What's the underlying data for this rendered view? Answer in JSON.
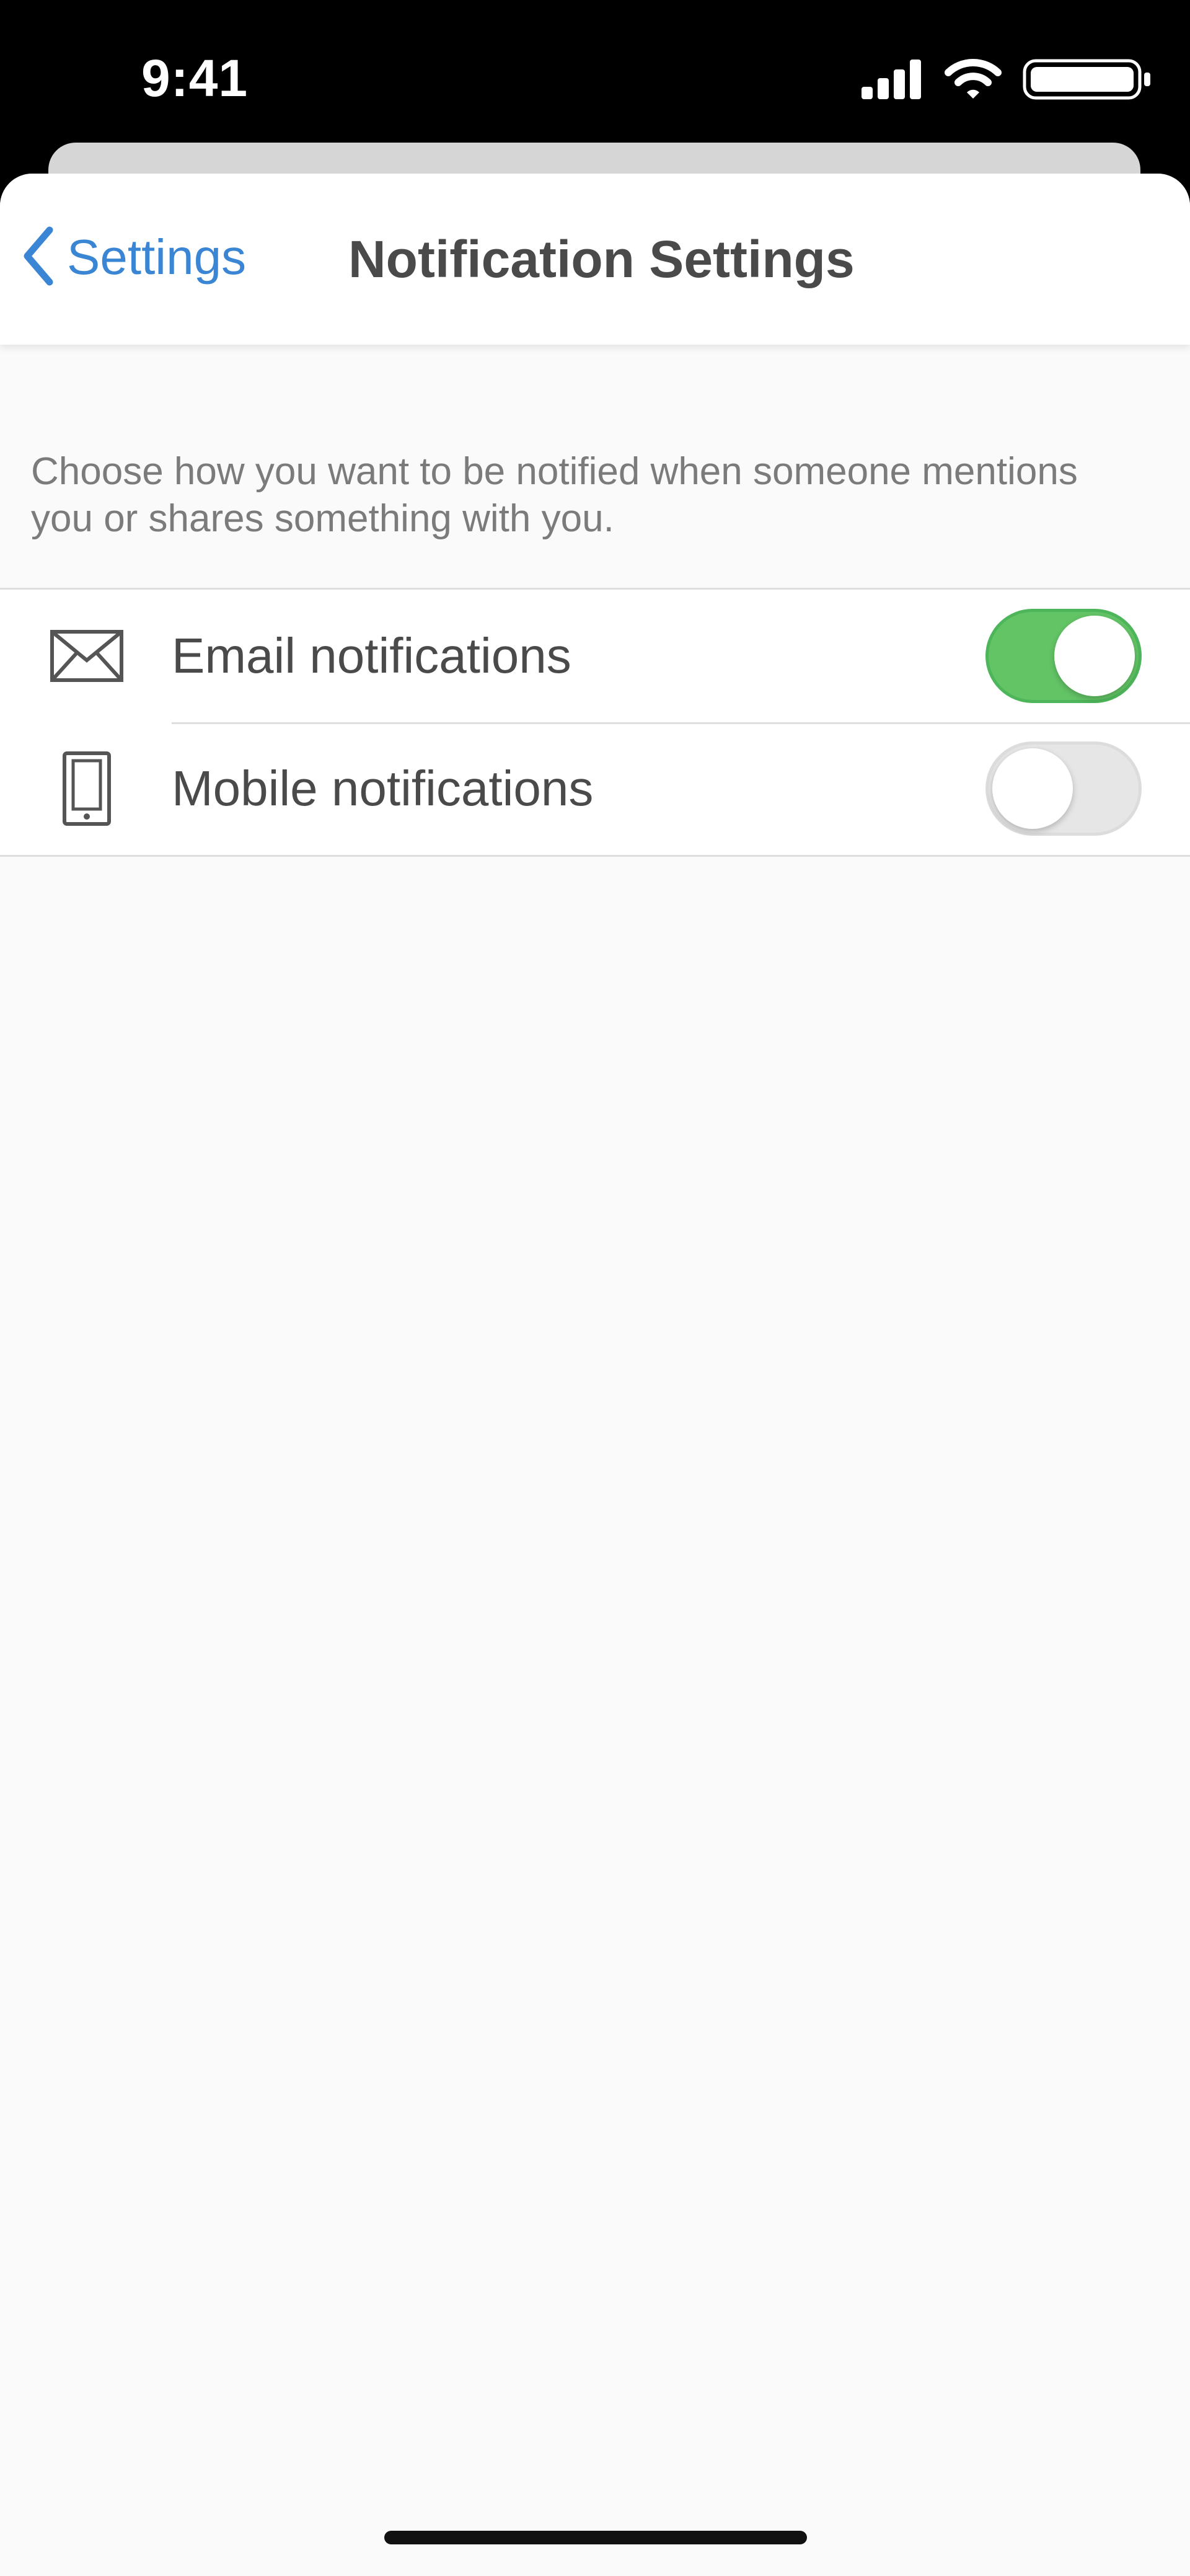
{
  "status_bar": {
    "time": "9:41",
    "icons": [
      "cellular-signal-icon",
      "wifi-icon",
      "battery-icon"
    ]
  },
  "nav": {
    "back_label": "Settings",
    "title": "Notification Settings"
  },
  "description": "Choose how you want to be notified when someone mentions you or shares something with you.",
  "settings": [
    {
      "icon": "envelope-icon",
      "label": "Email notifications",
      "enabled": true
    },
    {
      "icon": "mobile-phone-icon",
      "label": "Mobile notifications",
      "enabled": false
    }
  ],
  "colors": {
    "accent": "#3a86d4",
    "toggle_on": "#63c466",
    "toggle_off": "#e6e6e6",
    "background": "#fafafa"
  }
}
